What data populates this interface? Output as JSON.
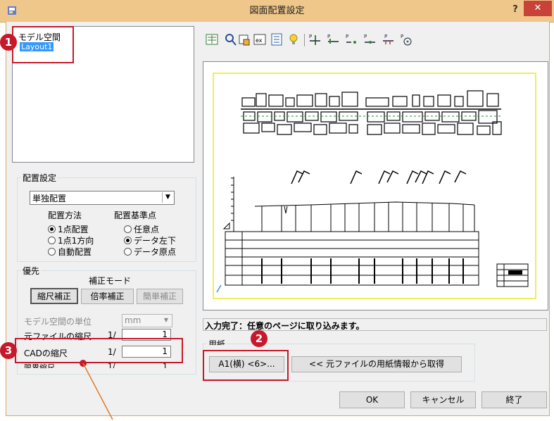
{
  "window": {
    "title": "図面配置設定",
    "help_label": "?",
    "close_label": "✕"
  },
  "tree": {
    "root_label": "モデル空間",
    "selected_label": "Layout1"
  },
  "placement": {
    "group_label": "配置設定",
    "combo_value": "単独配置",
    "method_label": "配置方法",
    "method_options": [
      "1点配置",
      "1点1方向",
      "自動配置"
    ],
    "basepoint_label": "配置基準点",
    "basepoint_options": [
      "任意点",
      "データ左下",
      "データ原点"
    ]
  },
  "priority": {
    "group_label": "優先",
    "mode_label": "補正モード",
    "buttons": [
      "縮尺補正",
      "倍率補正",
      "簡単補正"
    ],
    "unit_label": "モデル空間の単位",
    "unit_value": "mm",
    "rows": [
      {
        "label": "元ファイルの縮尺",
        "prefix": "1/",
        "value": "1"
      },
      {
        "label": "CADの縮尺",
        "prefix": "1/",
        "value": "1"
      },
      {
        "label": "限界縮尺",
        "prefix": "1/",
        "value": "1"
      }
    ]
  },
  "status": {
    "message": "入力完了：任意のページに取り込みます。"
  },
  "paper": {
    "group_label": "用紙",
    "size_button": "A1(横) <6>...",
    "from_source_button": "<< 元ファイルの用紙情報から取得"
  },
  "footer": {
    "ok": "OK",
    "cancel": "キャンセル",
    "finish": "終了"
  },
  "markers": [
    "1",
    "2",
    "3"
  ],
  "toolbar": {
    "icons": [
      "layout-icon",
      "zoom-icon",
      "fit-icon",
      "extents-icon",
      "scale-icon",
      "lightbulb-icon",
      "point-cross-icon",
      "point-line-icon",
      "point-dot-icon",
      "point-dotline-icon",
      "point-rail-icon",
      "point-circle-icon"
    ]
  },
  "colors": {
    "title_bar": "#f0c78a",
    "close_button": "#c7433a",
    "marker": "#c6192b",
    "selection": "#3399ff",
    "page_border": "#e8e82c"
  }
}
